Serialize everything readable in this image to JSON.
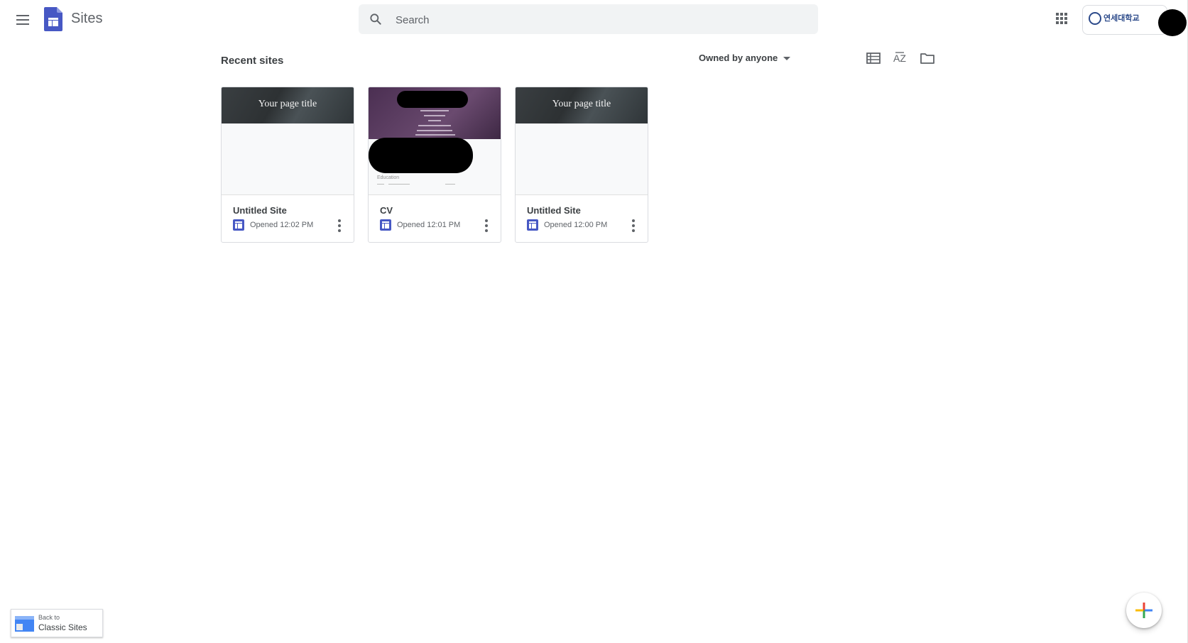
{
  "app": {
    "title": "Sites"
  },
  "search": {
    "placeholder": "Search"
  },
  "org": {
    "name": "연세대학교"
  },
  "main": {
    "section_title": "Recent sites",
    "owner_filter": "Owned by anyone",
    "sort_label": "AZ"
  },
  "sites": [
    {
      "name": "Untitled Site",
      "opened": "Opened 12:02 PM",
      "thumb_title": "Your page title"
    },
    {
      "name": "CV",
      "opened": "Opened 12:01 PM",
      "thumb_section": "Education"
    },
    {
      "name": "Untitled Site",
      "opened": "Opened 12:00 PM",
      "thumb_title": "Your page title"
    }
  ],
  "classic": {
    "small": "Back to",
    "big": "Classic Sites"
  },
  "colors": {
    "brand": "#4758c4",
    "cv_banner": "#5b3d61"
  },
  "icons": [
    "menu-icon",
    "sites-logo-icon",
    "search-icon",
    "apps-grid-icon",
    "list-view-icon",
    "sort-az-icon",
    "folder-icon",
    "site-doc-icon",
    "more-vert-icon",
    "plus-icon"
  ]
}
